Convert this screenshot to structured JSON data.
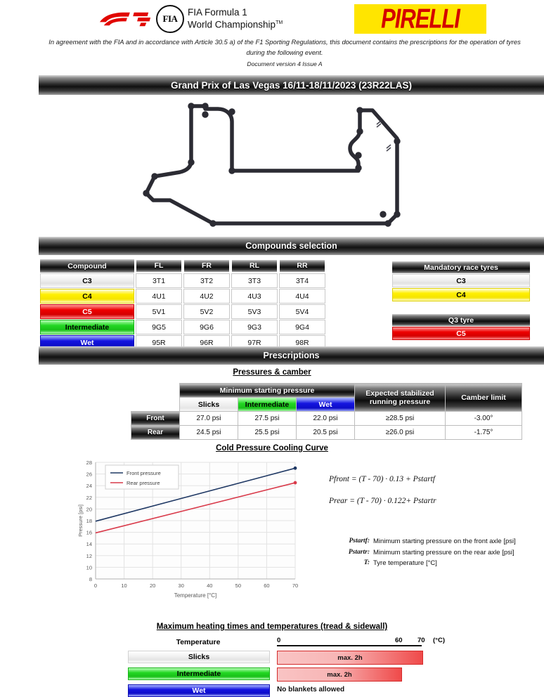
{
  "header": {
    "f1_logo": "f1-logo",
    "fia_badge_text": "FIA",
    "fia_line1": "FIA Formula 1",
    "fia_line2": "World Championship",
    "fia_tm": "TM",
    "pirelli_logo": "PIRELLI",
    "intro": "In agreement with the FIA and in accordance with Article 30.5 a) of the F1 Sporting Regulations, this document contains the prescriptions for the operation of tyres during the following event.",
    "document_version": "Document version 4   Issue A",
    "event_title": "Grand Prix of Las Vegas   16/11-18/11/2023   (23R22LAS)"
  },
  "sections": {
    "compounds_banner": "Compounds selection",
    "prescriptions_banner": "Prescriptions",
    "pressures_camber_title": "Pressures & camber",
    "cooling_curve_title": "Cold Pressure Cooling Curve",
    "heating_title": "Maximum heating times and temperatures (tread & sidewall)"
  },
  "compounds": {
    "columns": [
      "Compound",
      "FL",
      "FR",
      "RL",
      "RR"
    ],
    "rows": [
      {
        "name": "C3",
        "fl": "3T1",
        "fr": "3T2",
        "rl": "3T3",
        "rr": "3T4"
      },
      {
        "name": "C4",
        "fl": "4U1",
        "fr": "4U2",
        "rl": "4U3",
        "rr": "4U4"
      },
      {
        "name": "C5",
        "fl": "5V1",
        "fr": "5V2",
        "rl": "5V3",
        "rr": "5V4"
      },
      {
        "name": "Intermediate",
        "fl": "9G5",
        "fr": "9G6",
        "rl": "9G3",
        "rr": "9G4"
      },
      {
        "name": "Wet",
        "fl": "95R",
        "fr": "96R",
        "rl": "97R",
        "rr": "98R"
      }
    ]
  },
  "mandatory_race_tyres": {
    "title": "Mandatory race tyres",
    "items": [
      "C3",
      "C4"
    ]
  },
  "q3_tyre": {
    "title": "Q3 tyre",
    "items": [
      "C5"
    ]
  },
  "pressures": {
    "group_header": "Minimum starting pressure",
    "col_slicks": "Slicks",
    "col_intermediate": "Intermediate",
    "col_wet": "Wet",
    "col_expected": "Expected stabilized running pressure",
    "col_camber": "Camber limit",
    "rows": [
      {
        "axle": "Front",
        "slicks": "27.0 psi",
        "intermediate": "27.5 psi",
        "wet": "22.0 psi",
        "expected": "≥28.5 psi",
        "camber": "-3.00°"
      },
      {
        "axle": "Rear",
        "slicks": "24.5 psi",
        "intermediate": "25.5 psi",
        "wet": "20.5 psi",
        "expected": "≥26.0 psi",
        "camber": "-1.75°"
      }
    ]
  },
  "chart_data": {
    "type": "line",
    "title": "Cold Pressure Cooling Curve",
    "xlabel": "Temperature [°C]",
    "ylabel": "Pressure [psi]",
    "xlim": [
      0,
      70
    ],
    "ylim": [
      8,
      28
    ],
    "xticks": [
      0,
      10,
      20,
      30,
      40,
      50,
      60,
      70
    ],
    "yticks": [
      8,
      10,
      12,
      14,
      16,
      18,
      20,
      22,
      24,
      26,
      28
    ],
    "grid": true,
    "legend_position": "top-left",
    "series": [
      {
        "name": "Front pressure",
        "color": "#1F3864",
        "x": [
          0,
          70
        ],
        "values": [
          17.9,
          27.0
        ]
      },
      {
        "name": "Rear pressure",
        "color": "#D93A4A",
        "x": [
          0,
          70
        ],
        "values": [
          15.9,
          24.5
        ]
      }
    ]
  },
  "formulas": {
    "front": "Pfront = (T - 70) · 0.13 + Pstartf",
    "rear": "Prear = (T - 70) · 0.122+ Pstartr",
    "definitions": [
      {
        "key": "Pstartf:",
        "text": "Minimum starting pressure on the front axle [psi]"
      },
      {
        "key": "Pstartr:",
        "text": "Minimum starting pressure on the rear axle [psi]"
      },
      {
        "key": "T:",
        "text": "Tyre temperature [°C]"
      }
    ]
  },
  "heating": {
    "temperature_label": "Temperature",
    "scale": {
      "start": "0",
      "mid": "60",
      "end": "70",
      "unit": "(°C)"
    },
    "rows": [
      {
        "tyre": "Slicks",
        "bar": "max. 2h",
        "limit": 70
      },
      {
        "tyre": "Intermediate",
        "bar": "max. 2h",
        "limit": 60
      },
      {
        "tyre": "Wet",
        "bar": "No blankets allowed",
        "limit": 0
      }
    ]
  }
}
